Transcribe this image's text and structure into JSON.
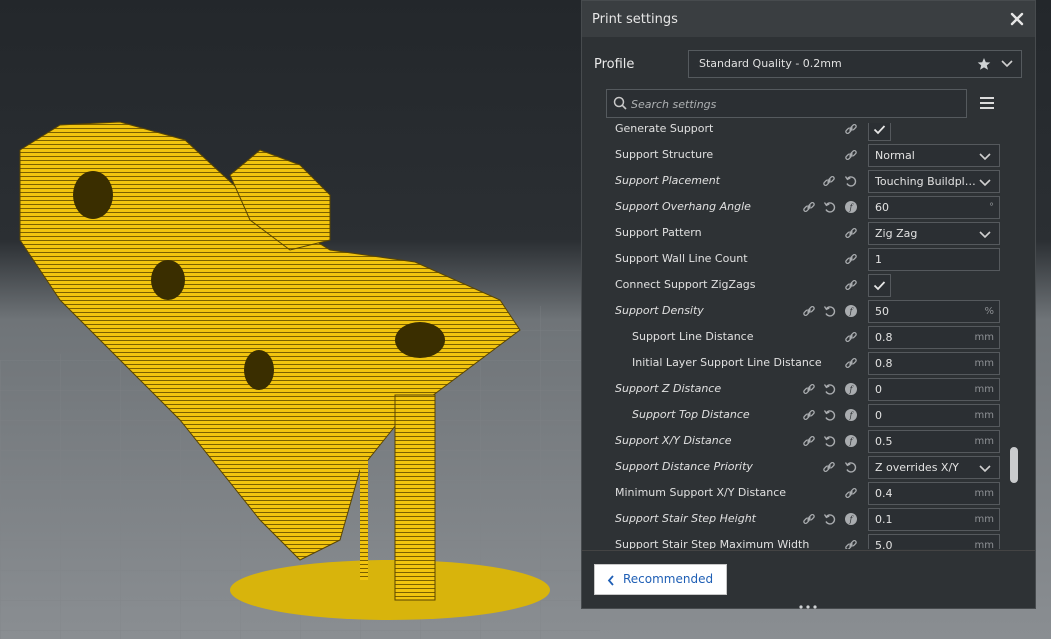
{
  "window": {
    "title": "Print settings"
  },
  "profile": {
    "label": "Profile",
    "value": "Standard Quality - 0.2mm"
  },
  "search": {
    "placeholder": "Search settings"
  },
  "settings": [
    {
      "label": "Generate Support",
      "indent": 0,
      "italic": false,
      "control": "checkbox",
      "value": "",
      "unit": ""
    },
    {
      "label": "Support Structure",
      "indent": 0,
      "italic": false,
      "control": "select",
      "value": "Normal",
      "unit": ""
    },
    {
      "label": "Support Placement",
      "indent": 0,
      "italic": true,
      "control": "select",
      "value": "Touching Buildpl…",
      "unit": ""
    },
    {
      "label": "Support Overhang Angle",
      "indent": 0,
      "italic": true,
      "control": "text",
      "value": "60",
      "unit": "°"
    },
    {
      "label": "Support Pattern",
      "indent": 0,
      "italic": false,
      "control": "select",
      "value": "Zig Zag",
      "unit": ""
    },
    {
      "label": "Support Wall Line Count",
      "indent": 0,
      "italic": false,
      "control": "text",
      "value": "1",
      "unit": ""
    },
    {
      "label": "Connect Support ZigZags",
      "indent": 0,
      "italic": false,
      "control": "checkbox",
      "value": "",
      "unit": ""
    },
    {
      "label": "Support Density",
      "indent": 0,
      "italic": true,
      "control": "text",
      "value": "50",
      "unit": "%"
    },
    {
      "label": "Support Line Distance",
      "indent": 1,
      "italic": false,
      "control": "text",
      "value": "0.8",
      "unit": "mm"
    },
    {
      "label": "Initial Layer Support Line Distance",
      "indent": 1,
      "italic": false,
      "control": "text",
      "value": "0.8",
      "unit": "mm"
    },
    {
      "label": "Support Z Distance",
      "indent": 0,
      "italic": true,
      "control": "text",
      "value": "0",
      "unit": "mm"
    },
    {
      "label": "Support Top Distance",
      "indent": 1,
      "italic": true,
      "control": "text",
      "value": "0",
      "unit": "mm"
    },
    {
      "label": "Support X/Y Distance",
      "indent": 0,
      "italic": true,
      "control": "text",
      "value": "0.5",
      "unit": "mm"
    },
    {
      "label": "Support Distance Priority",
      "indent": 0,
      "italic": true,
      "control": "select",
      "value": "Z overrides X/Y",
      "unit": ""
    },
    {
      "label": "Minimum Support X/Y Distance",
      "indent": 0,
      "italic": false,
      "control": "text",
      "value": "0.4",
      "unit": "mm"
    },
    {
      "label": "Support Stair Step Height",
      "indent": 0,
      "italic": true,
      "control": "text",
      "value": "0.1",
      "unit": "mm"
    },
    {
      "label": "Support Stair Step Maximum Width",
      "indent": 0,
      "italic": false,
      "control": "text",
      "value": "5.0",
      "unit": "mm"
    }
  ],
  "footer": {
    "recommended_label": "Recommended"
  },
  "colors": {
    "accent": "#1f5fb5",
    "model": "#f2c00f"
  }
}
